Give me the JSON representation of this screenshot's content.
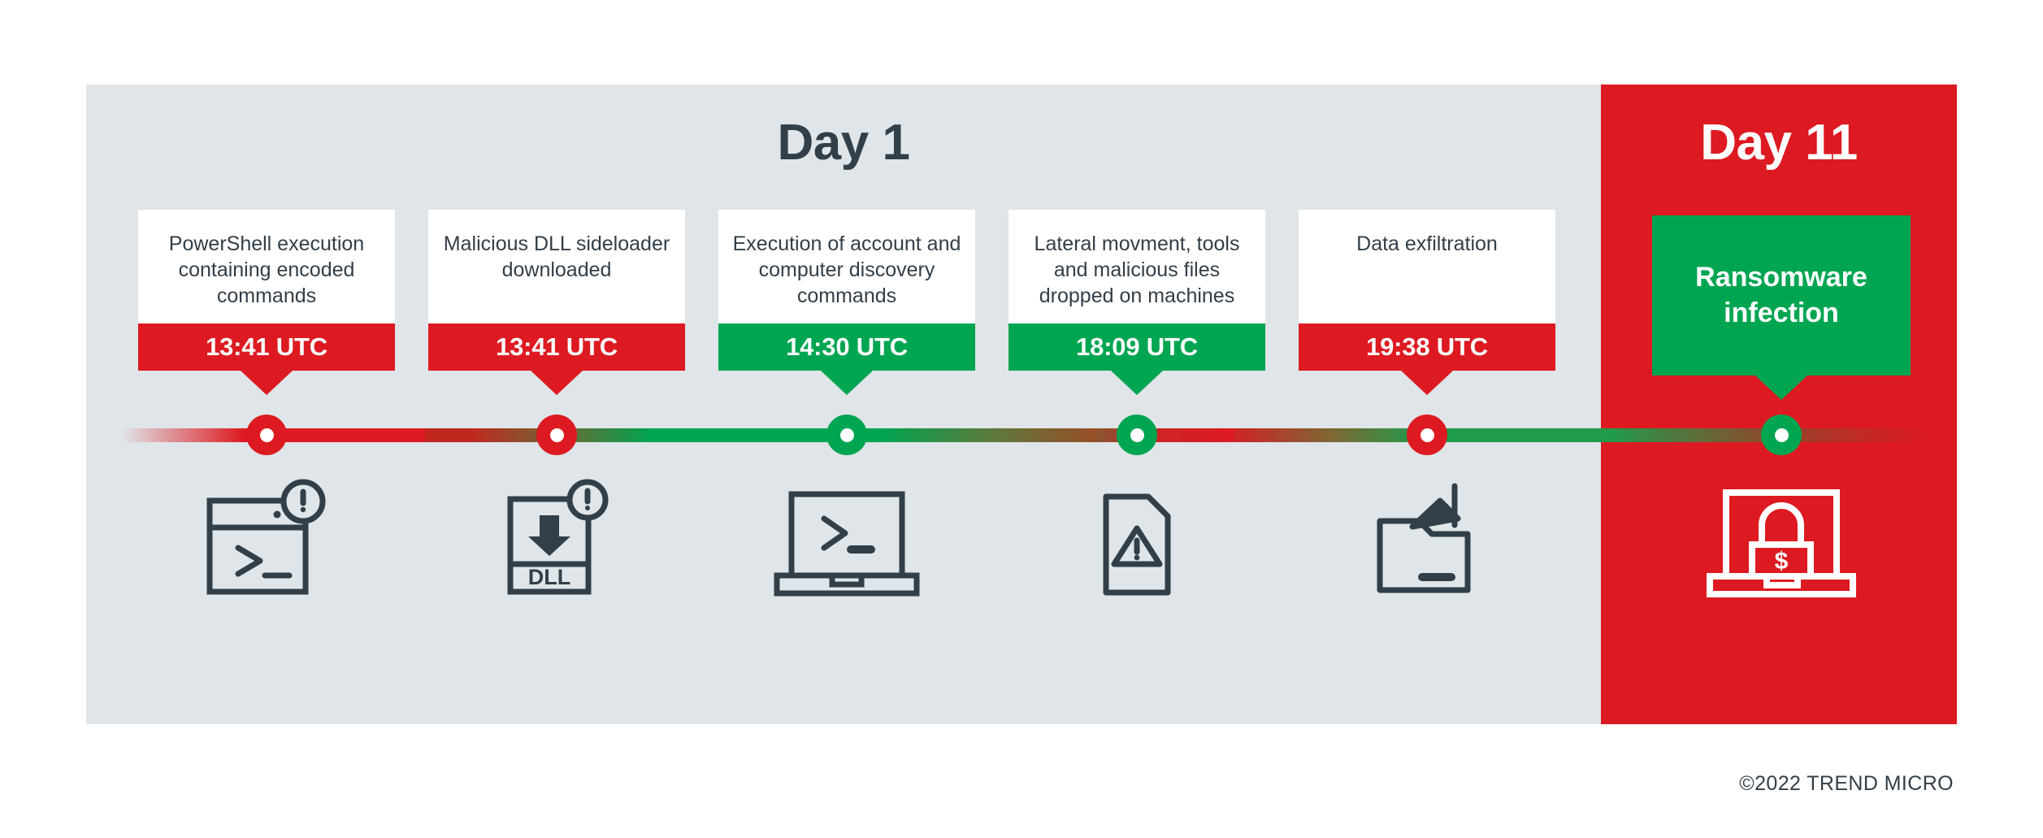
{
  "colors": {
    "panel_bg": "#dfe5e8",
    "accent_red": "#dd1a21",
    "accent_green": "#00a551",
    "ink": "#323e48",
    "white": "#ffffff"
  },
  "panels": {
    "day1": {
      "title": "Day 1"
    },
    "day11": {
      "title": "Day 11"
    }
  },
  "events": [
    {
      "description": "PowerShell execution containing encoded commands",
      "time": "13:41 UTC",
      "time_color": "red",
      "dot_color": "red",
      "icon": "terminal-window-alert-icon"
    },
    {
      "description": "Malicious DLL sideloader downloaded",
      "time": "13:41 UTC",
      "time_color": "red",
      "dot_color": "red",
      "icon": "dll-download-alert-icon"
    },
    {
      "description": "Execution of account and computer discovery commands",
      "time": "14:30 UTC",
      "time_color": "green",
      "dot_color": "green",
      "icon": "laptop-terminal-icon"
    },
    {
      "description": "Lateral movment, tools and malicious files dropped on machines",
      "time": "18:09 UTC",
      "time_color": "green",
      "dot_color": "green",
      "icon": "document-warning-icon"
    },
    {
      "description": "Data exfiltration",
      "time": "19:38 UTC",
      "time_color": "red",
      "dot_color": "red",
      "icon": "folder-exfiltration-icon"
    }
  ],
  "final_event": {
    "label": "Ransomware infection",
    "dot_color": "green",
    "icon": "laptop-lock-ransom-icon"
  },
  "footer": {
    "copyright": "©2022 TREND MICRO"
  }
}
